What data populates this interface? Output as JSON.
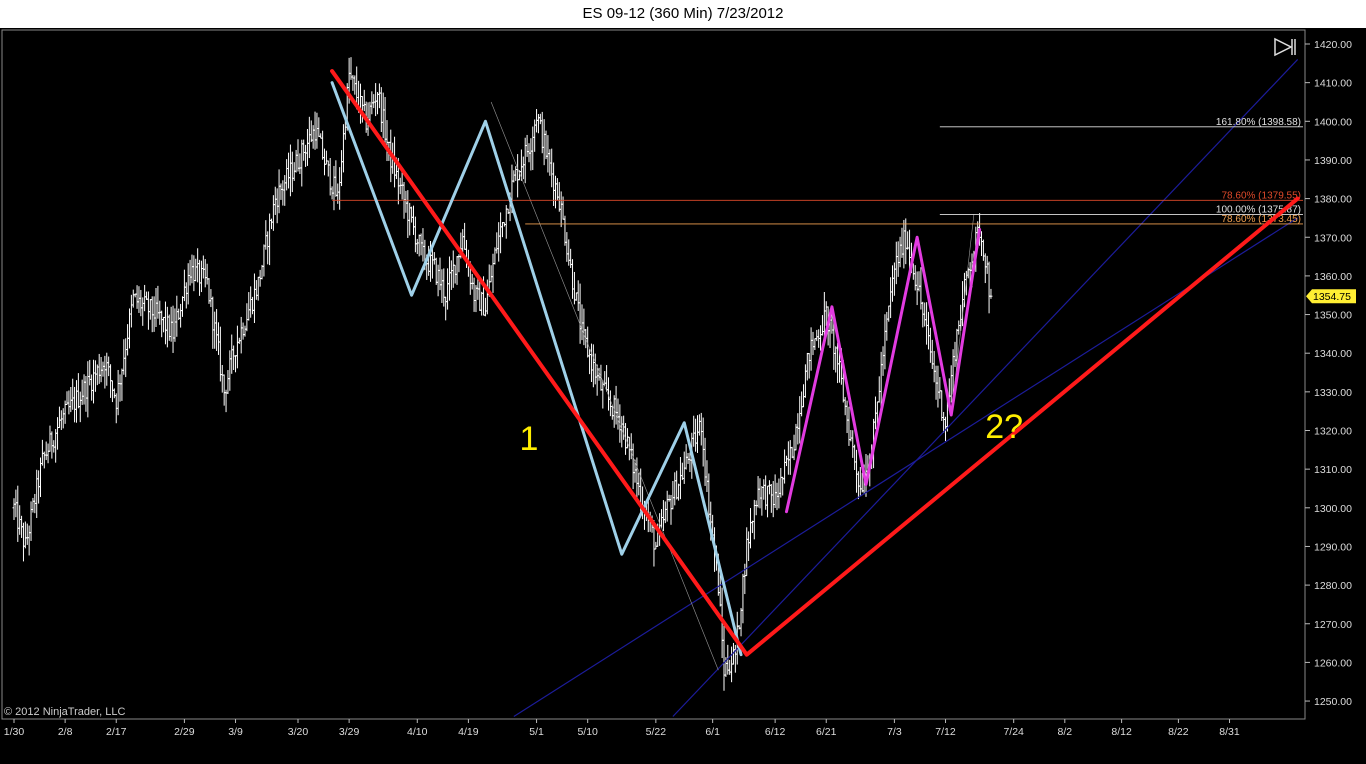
{
  "title": "ES 09-12 (360 Min)  7/23/2012",
  "copyright": "© 2012 NinjaTrader, LLC",
  "colors": {
    "background": "#000000",
    "bars": "#ffffff",
    "wave1": "#ff1a1a",
    "subwave": "#9fd0e8",
    "corrective": "#e23be0",
    "trendline": "#1c1c9a",
    "fib_red": "#e04a2a",
    "fib_orange": "#f0a050",
    "fib_white": "#e0e0e0",
    "annotation": "#ffee00",
    "price_badge": "#ffee33"
  },
  "icons": {
    "play": "play-to-end-icon"
  },
  "chart_data": {
    "type": "ohlc-bars",
    "instrument": "ES 09-12",
    "interval": "360 Min",
    "x_ticks": [
      {
        "label": "1/30",
        "d": 0
      },
      {
        "label": "2/8",
        "d": 9
      },
      {
        "label": "2/17",
        "d": 18
      },
      {
        "label": "2/29",
        "d": 30
      },
      {
        "label": "3/9",
        "d": 39
      },
      {
        "label": "3/20",
        "d": 50
      },
      {
        "label": "3/29",
        "d": 59
      },
      {
        "label": "4/10",
        "d": 71
      },
      {
        "label": "4/19",
        "d": 80
      },
      {
        "label": "5/1",
        "d": 92
      },
      {
        "label": "5/10",
        "d": 101
      },
      {
        "label": "5/22",
        "d": 113
      },
      {
        "label": "6/1",
        "d": 123
      },
      {
        "label": "6/12",
        "d": 134
      },
      {
        "label": "6/21",
        "d": 143
      },
      {
        "label": "7/3",
        "d": 155
      },
      {
        "label": "7/12",
        "d": 164
      },
      {
        "label": "7/24",
        "d": 176
      },
      {
        "label": "8/2",
        "d": 185
      },
      {
        "label": "8/12",
        "d": 195
      },
      {
        "label": "8/22",
        "d": 205
      },
      {
        "label": "8/31",
        "d": 214
      }
    ],
    "ylim": [
      1246,
      1422
    ],
    "y_ticks": [
      1250,
      1260,
      1270,
      1280,
      1290,
      1300,
      1310,
      1320,
      1330,
      1340,
      1350,
      1360,
      1370,
      1380,
      1390,
      1400,
      1410,
      1420
    ],
    "y_tick_labels": [
      "1250.00",
      "1260.00",
      "1270.00",
      "1280.00",
      "1290.00",
      "1300.00",
      "1310.00",
      "1320.00",
      "1330.00",
      "1340.00",
      "1350.00",
      "1360.00",
      "1370.00",
      "1380.00",
      "1390.00",
      "1400.00",
      "1410.00",
      "1420.00"
    ],
    "last_price": 1354.75,
    "last_price_label": "1354.75",
    "price_path": [
      [
        0,
        1300
      ],
      [
        2,
        1290
      ],
      [
        5,
        1312
      ],
      [
        8,
        1322
      ],
      [
        12,
        1330
      ],
      [
        16,
        1338
      ],
      [
        18,
        1328
      ],
      [
        21,
        1354
      ],
      [
        25,
        1350
      ],
      [
        28,
        1345
      ],
      [
        31,
        1362
      ],
      [
        34,
        1358
      ],
      [
        36,
        1340
      ],
      [
        37,
        1330
      ],
      [
        39,
        1342
      ],
      [
        43,
        1358
      ],
      [
        46,
        1380
      ],
      [
        50,
        1390
      ],
      [
        53,
        1398
      ],
      [
        55,
        1388
      ],
      [
        57,
        1380
      ],
      [
        59,
        1412
      ],
      [
        62,
        1400
      ],
      [
        64,
        1408
      ],
      [
        66,
        1392
      ],
      [
        69,
        1378
      ],
      [
        72,
        1365
      ],
      [
        74,
        1362
      ],
      [
        76,
        1355
      ],
      [
        79,
        1370
      ],
      [
        81,
        1355
      ],
      [
        83,
        1352
      ],
      [
        85,
        1368
      ],
      [
        88,
        1385
      ],
      [
        91,
        1395
      ],
      [
        92,
        1402
      ],
      [
        94,
        1390
      ],
      [
        96,
        1380
      ],
      [
        98,
        1362
      ],
      [
        100,
        1345
      ],
      [
        103,
        1332
      ],
      [
        107,
        1322
      ],
      [
        110,
        1305
      ],
      [
        113,
        1290
      ],
      [
        115,
        1300
      ],
      [
        118,
        1310
      ],
      [
        121,
        1322
      ],
      [
        122,
        1305
      ],
      [
        124,
        1280
      ],
      [
        125,
        1258
      ],
      [
        127,
        1262
      ],
      [
        129,
        1290
      ],
      [
        131,
        1305
      ],
      [
        134,
        1302
      ],
      [
        137,
        1315
      ],
      [
        140,
        1340
      ],
      [
        143,
        1350
      ],
      [
        145,
        1338
      ],
      [
        147,
        1320
      ],
      [
        149,
        1305
      ],
      [
        151,
        1315
      ],
      [
        153,
        1340
      ],
      [
        155,
        1362
      ],
      [
        157,
        1370
      ],
      [
        159,
        1358
      ],
      [
        162,
        1335
      ],
      [
        164,
        1322
      ],
      [
        166,
        1345
      ],
      [
        168,
        1362
      ],
      [
        170,
        1372
      ],
      [
        171,
        1365
      ],
      [
        172,
        1354.75
      ]
    ],
    "overlays": {
      "wave1_red": [
        [
          56,
          1413
        ],
        [
          129,
          1262
        ],
        [
          226,
          1380
        ]
      ],
      "subwave_lightblue": [
        [
          56,
          1410
        ],
        [
          70,
          1355
        ],
        [
          83,
          1400
        ],
        [
          107,
          1288
        ],
        [
          118,
          1322
        ],
        [
          128,
          1262
        ]
      ],
      "corrective_magenta": [
        [
          136,
          1299
        ],
        [
          144,
          1352
        ],
        [
          150,
          1306
        ],
        [
          159,
          1370
        ],
        [
          165,
          1324
        ],
        [
          170,
          1372
        ]
      ],
      "thin_lines": [
        [
          [
            84,
            1405
          ],
          [
            124,
            1258
          ]
        ],
        [
          [
            165,
            1324
          ],
          [
            169,
            1376
          ]
        ]
      ],
      "trendlines_blue": [
        [
          [
            88,
            1246
          ],
          [
            226,
            1375
          ]
        ],
        [
          [
            116,
            1246
          ],
          [
            226,
            1416
          ]
        ]
      ],
      "fib_levels": [
        {
          "label": "161.80% (1398.58)",
          "value": 1398.58,
          "start_d": 163,
          "color": "#e0e0e0"
        },
        {
          "label": "78.60% (1379.55)",
          "value": 1379.55,
          "start_d": 56,
          "color": "#e04a2a"
        },
        {
          "label": "100.00% (1375.87)",
          "value": 1375.87,
          "start_d": 163,
          "color": "#e0e0e0"
        },
        {
          "label": "78.60% (1373.45)",
          "value": 1373.45,
          "start_d": 90,
          "color": "#f0a050"
        }
      ],
      "annotations": [
        {
          "text": "1",
          "d": 89,
          "y": 1315
        },
        {
          "text": "2?",
          "d": 171,
          "y": 1318
        }
      ]
    }
  }
}
